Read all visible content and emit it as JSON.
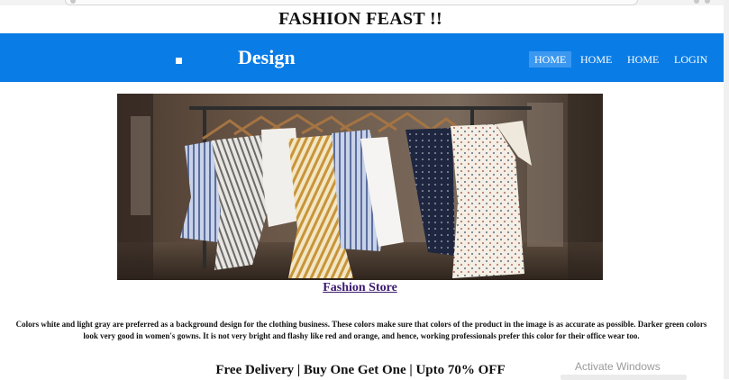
{
  "header": {
    "title": "FASHION FEAST !!"
  },
  "navbar": {
    "brand": "Design",
    "links": [
      {
        "label": "HOME",
        "active": true
      },
      {
        "label": "HOME",
        "active": false
      },
      {
        "label": "HOME",
        "active": false
      },
      {
        "label": "LOGIN",
        "active": false
      }
    ],
    "color": "#0a7ce6"
  },
  "hero": {
    "caption": "Fashion Store"
  },
  "description": "Colors white and light gray are preferred as a background design for the clothing business. These colors make sure that colors of the product in the image is as accurate as possible. Darker green colors look very good in women's gowns. It is not very bright and flashy like red and orange, and hence, working professionals prefer this color for their office wear too.",
  "promo": "Free Delivery | Buy One Get One | Upto 70% OFF",
  "os_overlay": {
    "watermark": "Activate Windows"
  }
}
